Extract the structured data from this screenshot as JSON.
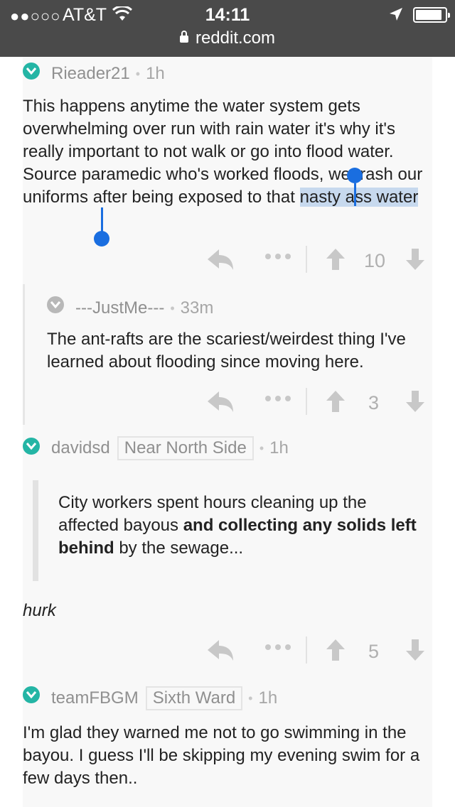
{
  "status_bar": {
    "signal": "●●○○○",
    "carrier": "AT&T",
    "time": "14:11",
    "url": "reddit.com"
  },
  "comments": [
    {
      "user": "Rieader21",
      "age": "1h",
      "flair": "",
      "text_before": "This happens anytime the water system gets overwhelming over run with rain water it's why it's really important to not walk or go into flood water. Source paramedic who's worked floods, we trash our uniforms after being exposed to that ",
      "text_highlight": "nasty ass water",
      "votes": "10"
    },
    {
      "user": "---JustMe---",
      "age": "33m",
      "flair": "",
      "text": "The ant-rafts are the scariest/weirdest thing I've learned about flooding since moving here.",
      "votes": "3"
    },
    {
      "user": "davidsd",
      "age": "1h",
      "flair": "Near North Side",
      "quote_start": "City workers spent hours cleaning up the affected bayous ",
      "quote_bold": "and collecting any solids left behind",
      "quote_end": " by the sewage...",
      "text": "hurk",
      "votes": "5"
    },
    {
      "user": "teamFBGM",
      "age": "1h",
      "flair": "Sixth Ward",
      "text": "I'm glad they warned me not to go swimming in the bayou. I guess I'll be skipping my evening swim for a few days then.."
    }
  ],
  "colors": {
    "status_bar_bg": "#4a4a4a",
    "accent_teal": "#24b5a5",
    "selection": "#c7d9ee",
    "selection_handle": "#1a6ee0"
  },
  "icons": [
    "wifi-icon",
    "location-arrow-icon",
    "battery-icon",
    "lock-icon",
    "check-circle-icon",
    "reply-icon",
    "more-icon",
    "upvote-icon",
    "downvote-icon"
  ]
}
